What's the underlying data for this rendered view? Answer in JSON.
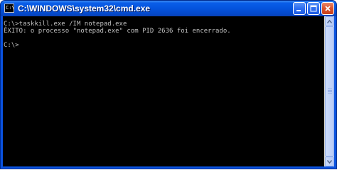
{
  "window": {
    "title": "C:\\WINDOWS\\system32\\cmd.exe",
    "icon": "console-icon",
    "icon_text": "C:\\"
  },
  "controls": {
    "minimize": "minimize-icon",
    "maximize": "maximize-icon",
    "close": "close-icon"
  },
  "console": {
    "lines": [
      "C:\\>taskkill.exe /IM notepad.exe",
      "ÊXITO: o processo \"notepad.exe\" com PID 2636 foi encerrado.",
      "C:\\>"
    ]
  },
  "colors": {
    "title_bar": "#0453dd",
    "console_background": "#000000",
    "console_text": "#c0c0c0",
    "close_button": "#d9522c"
  }
}
